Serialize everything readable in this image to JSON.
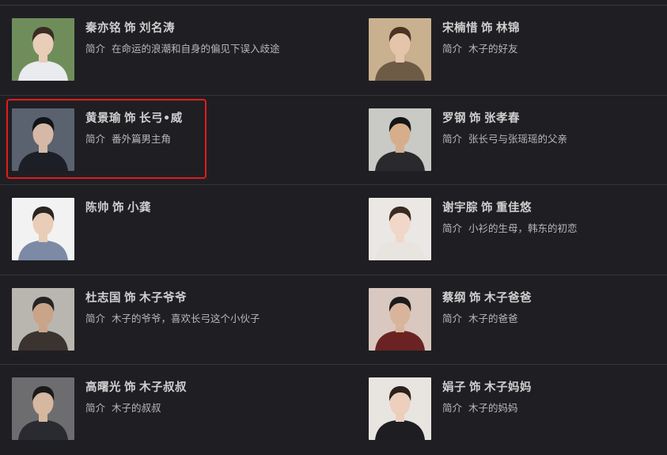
{
  "cast": [
    {
      "actor": "秦亦铭",
      "role_sep": "饰",
      "character": "刘名涛",
      "intro_label": "简介",
      "intro": "在命运的浪潮和自身的偏见下误入歧途",
      "bg": "#6f8d5a",
      "skin": "#e8cdb8",
      "shirt": "#e9ebef",
      "hair": "#3a2c22"
    },
    {
      "actor": "宋楠惜",
      "role_sep": "饰",
      "character": "林锦",
      "intro_label": "简介",
      "intro": "木子的好友",
      "bg": "#c9b08f",
      "skin": "#e6c4a9",
      "shirt": "#6d5b45",
      "hair": "#4a3323"
    },
    {
      "actor": "黄景瑜",
      "role_sep": "饰",
      "character": "长弓•威",
      "intro_label": "简介",
      "intro": "番外篇男主角",
      "bg": "#5a6270",
      "skin": "#d5b9a6",
      "shirt": "#1c1f26",
      "hair": "#121418"
    },
    {
      "actor": "罗钢",
      "role_sep": "饰",
      "character": "张孝春",
      "intro_label": "简介",
      "intro": "张长弓与张瑶瑶的父亲",
      "bg": "#c9c9c6",
      "skin": "#d7ae8c",
      "shirt": "#2a2a2e",
      "hair": "#151515"
    },
    {
      "actor": "陈帅",
      "role_sep": "饰",
      "character": "小龚",
      "intro_label": "",
      "intro": "",
      "bg": "#f2f2f2",
      "skin": "#e9cdb8",
      "shirt": "#7d8aa6",
      "hair": "#2a2520"
    },
    {
      "actor": "谢宇腙",
      "role_sep": "饰",
      "character": "重佳悠",
      "intro_label": "简介",
      "intro": "小衫的生母，韩东的初恋",
      "bg": "#ebe7e4",
      "skin": "#f0d7c8",
      "shirt": "#e8e4df",
      "hair": "#3a2a22"
    },
    {
      "actor": "杜志国",
      "role_sep": "饰",
      "character": "木子爷爷",
      "intro_label": "简介",
      "intro": "木子的爷爷，喜欢长弓这个小伙子",
      "bg": "#b9b6b0",
      "skin": "#c9a489",
      "shirt": "#3b3330",
      "hair": "#242424"
    },
    {
      "actor": "蔡纲",
      "role_sep": "饰",
      "character": "木子爸爸",
      "intro_label": "简介",
      "intro": "木子的爸爸",
      "bg": "#d9c8c0",
      "skin": "#d8b59a",
      "shirt": "#6b2222",
      "hair": "#1c1b1b"
    },
    {
      "actor": "高曙光",
      "role_sep": "饰",
      "character": "木子叔叔",
      "intro_label": "简介",
      "intro": "木子的叔叔",
      "bg": "#6d6d70",
      "skin": "#d6b7a0",
      "shirt": "#2a2b30",
      "hair": "#1a1a1a"
    },
    {
      "actor": "娟子",
      "role_sep": "饰",
      "character": "木子妈妈",
      "intro_label": "简介",
      "intro": "木子的妈妈",
      "bg": "#e8e5e1",
      "skin": "#eccfbc",
      "shirt": "#1e1e22",
      "hair": "#2c211b"
    }
  ]
}
